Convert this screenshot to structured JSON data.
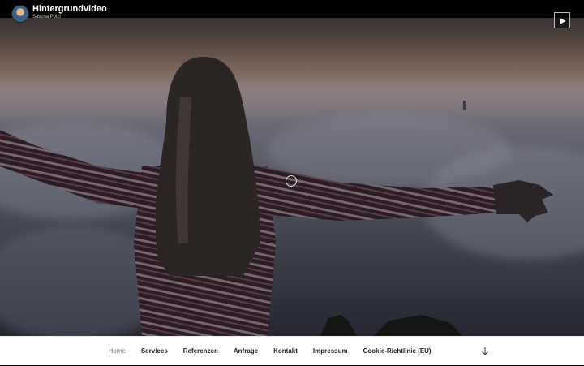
{
  "video": {
    "title": "Hintergrundvideo",
    "author": "Sascha Pölzl",
    "play_icon": "play-icon",
    "loading_icon": "loading-spinner-icon"
  },
  "nav": {
    "items": [
      {
        "label": "Home",
        "active": true
      },
      {
        "label": "Services",
        "active": false
      },
      {
        "label": "Referenzen",
        "active": false
      },
      {
        "label": "Anfrage",
        "active": false
      },
      {
        "label": "Kontakt",
        "active": false
      },
      {
        "label": "Impressum",
        "active": false
      },
      {
        "label": "Cookie-Richtlinie (EU)",
        "active": false
      }
    ],
    "scroll_icon": "arrow-down-icon"
  },
  "colors": {
    "nav_background": "#ffffff",
    "nav_text": "#222222",
    "nav_active_text": "#767676",
    "topbar_background": "#000000"
  }
}
